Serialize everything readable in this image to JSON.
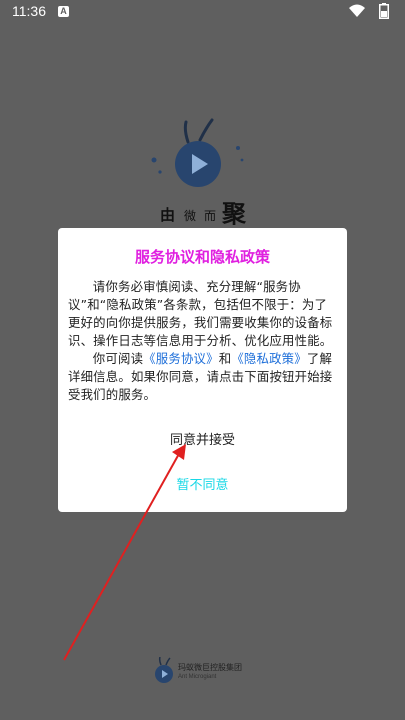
{
  "status_bar": {
    "time": "11:36",
    "notification_glyph": "A",
    "icons": [
      "wifi-icon",
      "battery-icon"
    ]
  },
  "splash": {
    "brand_chars": [
      "由",
      "微",
      "而",
      "聚"
    ]
  },
  "dialog": {
    "title": "服务协议和隐私政策",
    "para1": "请你务必审慎阅读、充分理解“服务协议”和“隐私政策”各条款，包括但不限于：为了更好的向你提供服务，我们需要收集你的设备标识、操作日志等信息用于分析、优化应用性能。",
    "para2_prefix": "你可阅读",
    "link_service": "《服务协议》",
    "para2_and": "和",
    "link_privacy": "《隐私政策》",
    "para2_suffix": "了解详细信息。如果你同意，请点击下面按钮开始接受我们的服务。",
    "accept_label": "同意并接受",
    "decline_label": "暂不同意"
  },
  "footer": {
    "company": "玛蚁微巨控股集团",
    "company_en": "Ant Microgiant"
  },
  "colors": {
    "title": "#e020e0",
    "link": "#1e6fd9",
    "decline": "#18d8e6",
    "overlay": "#5f5f5f",
    "arrow": "#e02020"
  }
}
